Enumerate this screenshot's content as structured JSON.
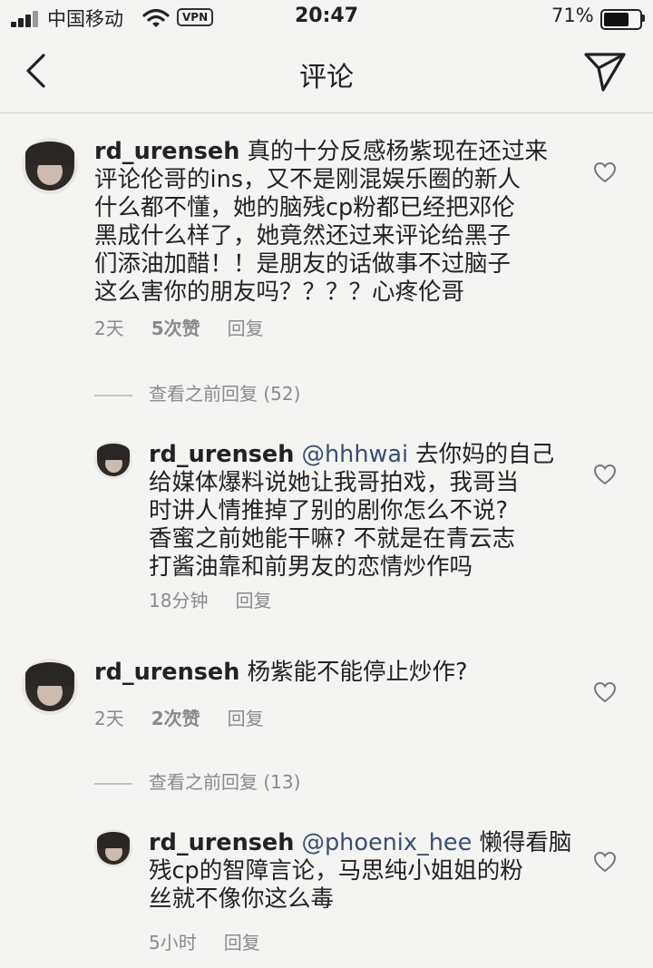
{
  "status": {
    "carrier": "中国移动",
    "vpn": "VPN",
    "time": "20:47",
    "battery": "71%"
  },
  "nav": {
    "title": "评论"
  },
  "comments": [
    {
      "user": "rd_urenseh",
      "lines": [
        "真的十分反感杨紫现在还过来",
        "评论伦哥的ins，又不是刚混娱乐圈的新人",
        "什么都不懂，她的脑残cp粉都已经把邓伦",
        "黑成什么样了，她竟然还过来评论给黑子",
        "们添油加醋！！是朋友的话做事不过脑子",
        "这么害你的朋友吗？？？？心疼伦哥"
      ],
      "time": "2天",
      "likes": "5次赞",
      "reply": "回复",
      "view_more": "查看之前回复 (52)"
    },
    {
      "user": "rd_urenseh",
      "mention": "@hhhwai",
      "lines": [
        "去你妈的自己",
        "给媒体爆料说她让我哥拍戏，我哥当",
        "时讲人情推掉了别的剧你怎么不说?",
        "香蜜之前她能干嘛? 不就是在青云志",
        "打酱油靠和前男友的恋情炒作吗"
      ],
      "time": "18分钟",
      "reply": "回复"
    },
    {
      "user": "rd_urenseh",
      "lines": [
        "杨紫能不能停止炒作?"
      ],
      "time": "2天",
      "likes": "2次赞",
      "reply": "回复",
      "view_more": "查看之前回复 (13)"
    },
    {
      "user": "rd_urenseh",
      "mention": "@phoenix_hee",
      "lines": [
        "懒得看脑",
        "残cp的智障言论，马思纯小姐姐的粉",
        "丝就不像你这么毒"
      ],
      "time": "5小时",
      "reply": "回复"
    }
  ]
}
